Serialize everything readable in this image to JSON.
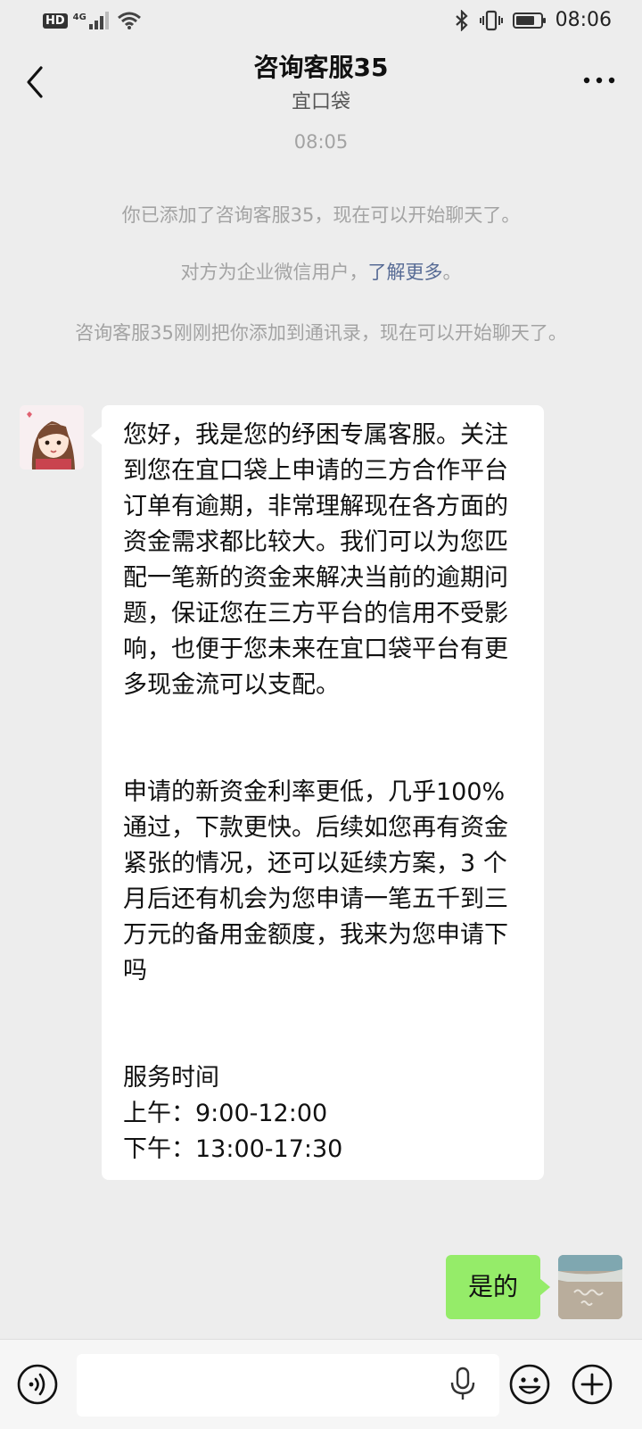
{
  "status_bar": {
    "network_badge": "HD",
    "network_type": "4G",
    "time": "08:06"
  },
  "header": {
    "title": "咨询客服35",
    "subtitle": "宜口袋"
  },
  "messages": {
    "timestamp": "08:05",
    "system_1": "你已添加了咨询客服35，现在可以开始聊天了。",
    "system_2_prefix": "对方为企业微信用户，",
    "system_2_link": "了解更多",
    "system_2_suffix": "。",
    "system_3": "咨询客服35刚刚把你添加到通讯录，现在可以开始聊天了。",
    "incoming": {
      "para1": "您好，我是您的纾困专属客服。关注到您在宜口袋上申请的三方合作平台订单有逾期，非常理解现在各方面的资金需求都比较大。我们可以为您匹配一笔新的资金来解决当前的逾期问题，保证您在三方平台的信用不受影响，也便于您未来在宜口袋平台有更多现金流可以支配。",
      "para2": "申请的新资金利率更低，几乎100% 通过，下款更快。后续如您再有资金紧张的情况，还可以延续方案，3 个月后还有机会为您申请一笔五千到三万元的备用金额度，我来为您申请下吗",
      "hours_title": "服务时间",
      "hours_am": "上午：9:00-12:00",
      "hours_pm": "下午：13:00-17:30"
    },
    "outgoing": "是的"
  },
  "input_bar": {
    "voice_icon": "voice-mode-icon",
    "mic_icon": "microphone-icon",
    "emoji_icon": "emoji-icon",
    "add_icon": "plus-icon"
  },
  "colors": {
    "background": "#ededed",
    "outgoing_bubble": "#95ec69",
    "incoming_bubble": "#ffffff",
    "link": "#576b95"
  }
}
